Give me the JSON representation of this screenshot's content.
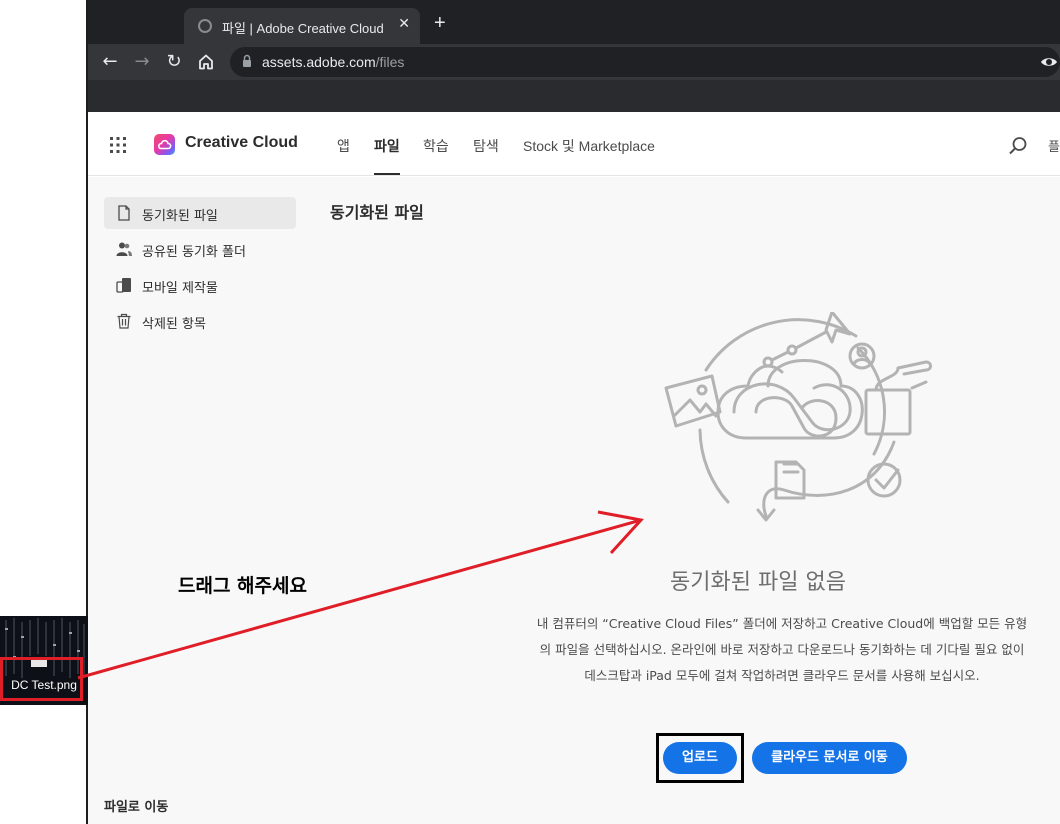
{
  "browser": {
    "tab_title": "파일 | Adobe Creative Cloud",
    "tab_close": "✕",
    "new_tab": "+",
    "back": "←",
    "forward": "→",
    "reload": "↻",
    "url_host": "assets.adobe.com",
    "url_path": "/files"
  },
  "app": {
    "brand": "Creative Cloud",
    "nav": [
      {
        "label": "앱",
        "active": false
      },
      {
        "label": "파일",
        "active": true
      },
      {
        "label": "학습",
        "active": false
      },
      {
        "label": "탐색",
        "active": false
      },
      {
        "label": "Stock 및 Marketplace",
        "active": false
      }
    ],
    "edge_text": "플"
  },
  "sidebar": {
    "items": [
      {
        "label": "동기화된 파일",
        "icon": "file-icon",
        "active": true
      },
      {
        "label": "공유된 동기화 폴더",
        "icon": "people-icon",
        "active": false
      },
      {
        "label": "모바일 제작물",
        "icon": "mobile-icon",
        "active": false
      },
      {
        "label": "삭제된 항목",
        "icon": "trash-icon",
        "active": false
      }
    ],
    "footer": "파일로 이동"
  },
  "main": {
    "title": "동기화된 파일",
    "empty_title": "동기화된 파일 없음",
    "empty_desc": "내 컴퓨터의 “Creative Cloud Files” 폴더에 저장하고 Creative Cloud에 백업할 모든 유형의 파일을 선택하십시오. 온라인에 바로 저장하고 다운로드나 동기화하는 데 기다릴 필요 없이 데스크탑과 iPad 모두에 걸쳐 작업하려면 클라우드 문서를 사용해 보십시오.",
    "upload_label": "업로드",
    "cloud_docs_label": "클라우드 문서로 이동"
  },
  "annotation": {
    "drag_hint": "드래그 해주세요",
    "file_name": "DC Test.png",
    "arrow_color": "#e01e28",
    "frame_color": "#e01e28"
  },
  "colors": {
    "accent": "#1473e6",
    "chrome_dark": "#202124",
    "chrome_mid": "#35363a"
  }
}
